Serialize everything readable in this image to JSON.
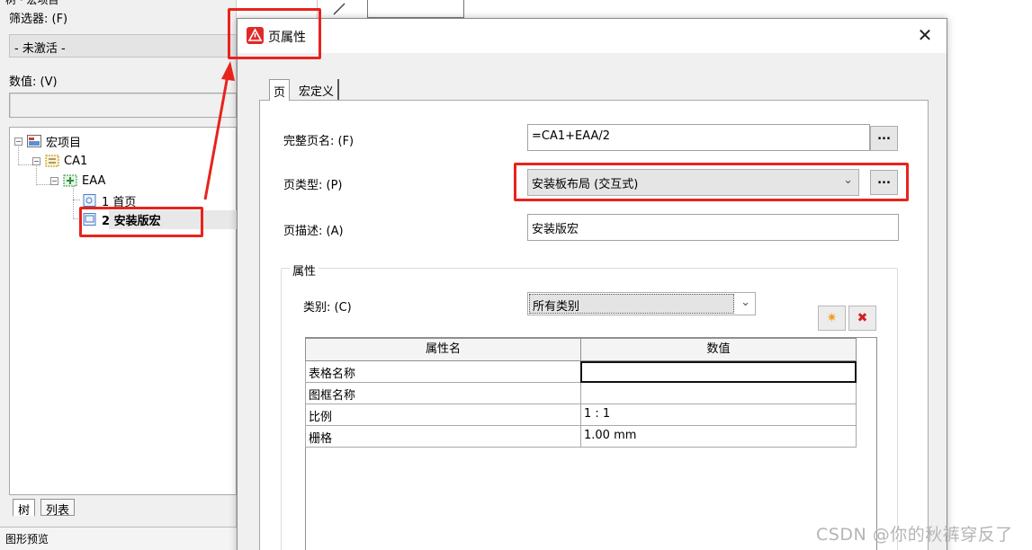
{
  "left_panel": {
    "title_fragment": "树 · 宏项目",
    "filter_label": "筛选器: (F)",
    "filter_value": "- 未激活 -",
    "value_label": "数值: (V)",
    "value_input": "",
    "tree": {
      "root": "宏项目",
      "ca1": "CA1",
      "eaa": "EAA",
      "page1": "1 首页",
      "page2": "2 安装版宏"
    },
    "tabs": [
      "树",
      "列表"
    ],
    "bottom_label": "图形预览"
  },
  "dialog": {
    "title": "页属性",
    "close_glyph": "✕",
    "tabs": [
      "页",
      "宏定义"
    ],
    "fields": {
      "full_page_name_label": "完整页名: (F)",
      "full_page_name_value": "=CA1+EAA/2",
      "page_type_label": "页类型: (P)",
      "page_type_value": "安装板布局 (交互式)",
      "page_desc_label": "页描述: (A)",
      "page_desc_value": "安装版宏",
      "browse_label": "..."
    },
    "properties": {
      "group_title": "属性",
      "category_label": "类别: (C)",
      "category_value": "所有类别",
      "new_button_glyph": "✷",
      "delete_button_glyph": "✖",
      "columns": [
        "属性名",
        "数值"
      ],
      "rows": [
        {
          "name": "表格名称",
          "value": ""
        },
        {
          "name": "图框名称",
          "value": ""
        },
        {
          "name": "比例",
          "value": "1 : 1"
        },
        {
          "name": "栅格",
          "value": "1.00 mm"
        }
      ]
    }
  },
  "watermark": "CSDN @你的秋裤穿反了",
  "colors": {
    "annotation_red": "#e8231c",
    "title_icon_red": "#e02a2a",
    "tree_selection": "#e8e8e8"
  }
}
